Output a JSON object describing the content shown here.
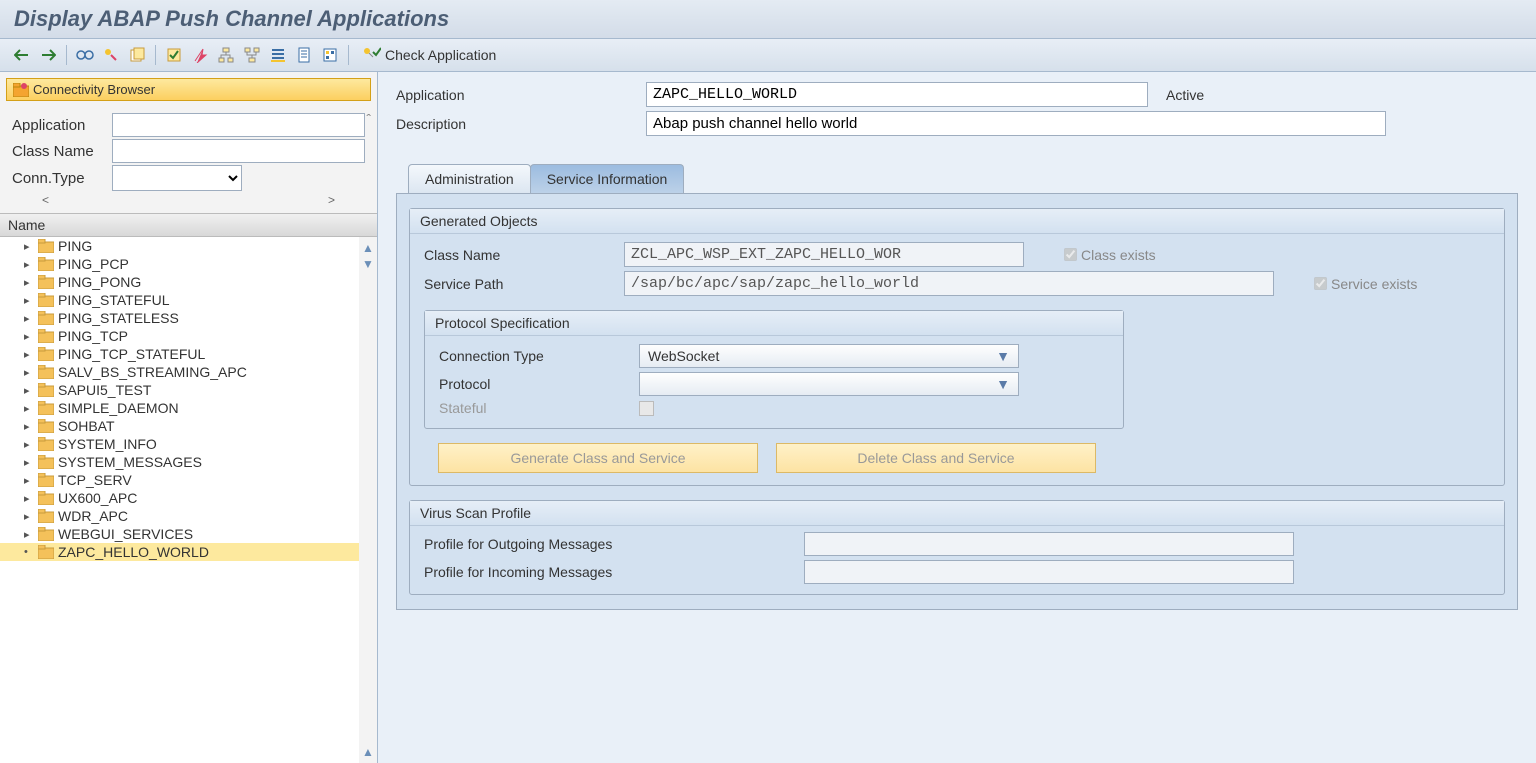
{
  "header": {
    "title": "Display ABAP Push Channel Applications"
  },
  "toolbar": {
    "check_app": "Check Application"
  },
  "left": {
    "browser_title": "Connectivity Browser",
    "filters": {
      "application": "Application",
      "class_name": "Class Name",
      "conn_type": "Conn.Type"
    },
    "tree_header": "Name",
    "items": [
      "PING",
      "PING_PCP",
      "PING_PONG",
      "PING_STATEFUL",
      "PING_STATELESS",
      "PING_TCP",
      "PING_TCP_STATEFUL",
      "SALV_BS_STREAMING_APC",
      "SAPUI5_TEST",
      "SIMPLE_DAEMON",
      "SOHBAT",
      "SYSTEM_INFO",
      "SYSTEM_MESSAGES",
      "TCP_SERV",
      "UX600_APC",
      "WDR_APC",
      "WEBGUI_SERVICES",
      "ZAPC_HELLO_WORLD"
    ],
    "selected": "ZAPC_HELLO_WORLD"
  },
  "detail": {
    "app_label": "Application",
    "app_value": "ZAPC_HELLO_WORLD",
    "status": "Active",
    "desc_label": "Description",
    "desc_value": "Abap push channel hello world"
  },
  "tabs": {
    "admin": "Administration",
    "service": "Service Information"
  },
  "generated": {
    "title": "Generated Objects",
    "class_label": "Class Name",
    "class_value": "ZCL_APC_WSP_EXT_ZAPC_HELLO_WOR",
    "class_exists": "Class exists",
    "service_label": "Service Path",
    "service_value": "/sap/bc/apc/sap/zapc_hello_world",
    "service_exists": "Service exists"
  },
  "protocol": {
    "title": "Protocol Specification",
    "conn_type_label": "Connection Type",
    "conn_type_value": "WebSocket",
    "protocol_label": "Protocol",
    "protocol_value": "",
    "stateful_label": "Stateful"
  },
  "buttons": {
    "generate": "Generate Class and Service",
    "delete": "Delete Class and Service"
  },
  "virus": {
    "title": "Virus Scan Profile",
    "outgoing": "Profile for Outgoing Messages",
    "incoming": "Profile for Incoming Messages"
  }
}
